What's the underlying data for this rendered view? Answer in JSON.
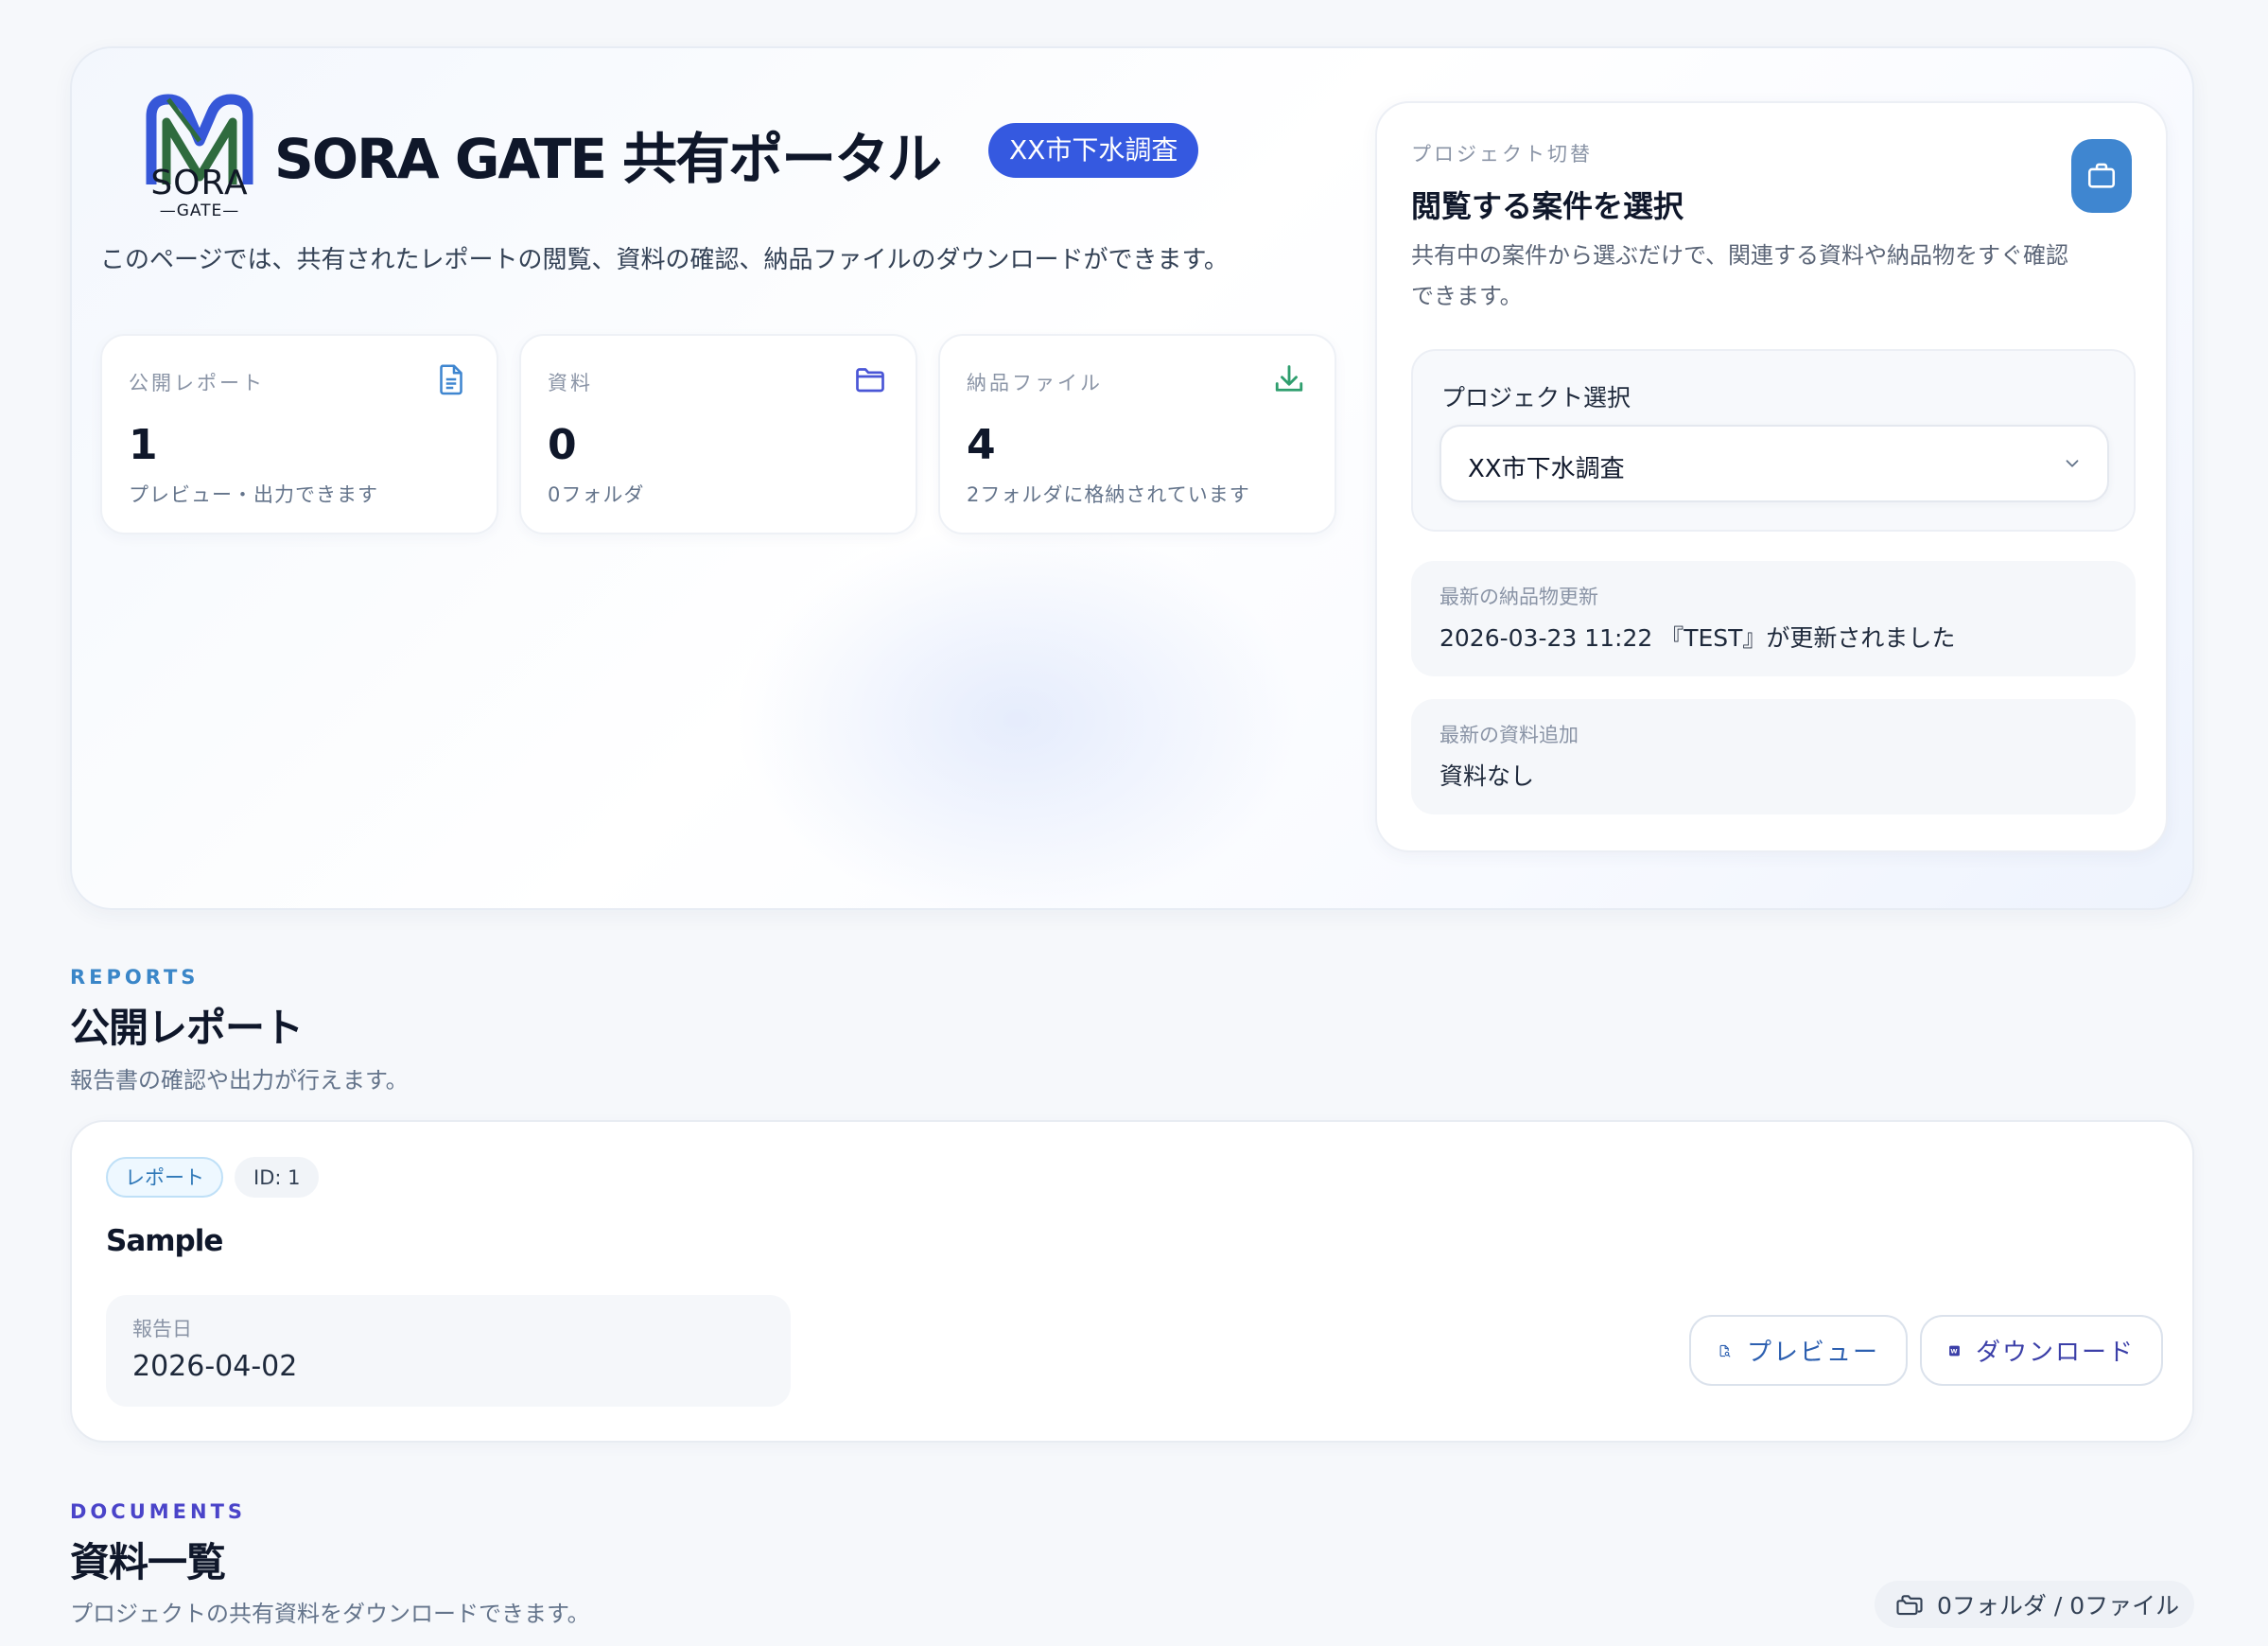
{
  "hero": {
    "logo": {
      "text": "SORA",
      "sub": "GATE"
    },
    "title": "SORA GATE 共有ポータル",
    "project_badge": "XX市下水調査",
    "description": "このページでは、共有されたレポートの閲覧、資料の確認、納品ファイルのダウンロードができます。"
  },
  "stats": [
    {
      "label": "公開レポート",
      "value": "1",
      "sub": "プレビュー・出力できます",
      "icon": "document-icon",
      "color": "#3f86d0"
    },
    {
      "label": "資料",
      "value": "0",
      "sub": "0フォルダ",
      "icon": "folder-icon",
      "color": "#4a56d6"
    },
    {
      "label": "納品ファイル",
      "value": "4",
      "sub": "2フォルダに格納されています",
      "icon": "download-icon",
      "color": "#2f9e6e"
    }
  ],
  "project_switch": {
    "kicker": "プロジェクト切替",
    "title": "閲覧する案件を選択",
    "description": "共有中の案件から選ぶだけで、関連する資料や納品物をすぐ確認できます。",
    "icon": "briefcase-icon",
    "select_label": "プロジェクト選択",
    "selected": "XX市下水調査",
    "latest_delivery_label": "最新の納品物更新",
    "latest_delivery_value": "2026-03-23 11:22 『TEST』が更新されました",
    "latest_docs_label": "最新の資料追加",
    "latest_docs_value": "資料なし"
  },
  "reports": {
    "kicker": "REPORTS",
    "title": "公開レポート",
    "description": "報告書の確認や出力が行えます。",
    "items": [
      {
        "tag": "レポート",
        "id_label": "ID: 1",
        "title": "Sample",
        "date_label": "報告日",
        "date_value": "2026-04-02",
        "preview_label": "プレビュー",
        "download_label": "ダウンロード"
      }
    ]
  },
  "documents": {
    "kicker": "DOCUMENTS",
    "title": "資料一覧",
    "description": "プロジェクトの共有資料をダウンロードできます。",
    "count": "0フォルダ / 0ファイル"
  },
  "colors": {
    "accent_blue": "#3559e0",
    "reports_kicker": "#3a86c8",
    "documents_kicker": "#4a44c9",
    "word_icon": "#3b3fa8"
  }
}
